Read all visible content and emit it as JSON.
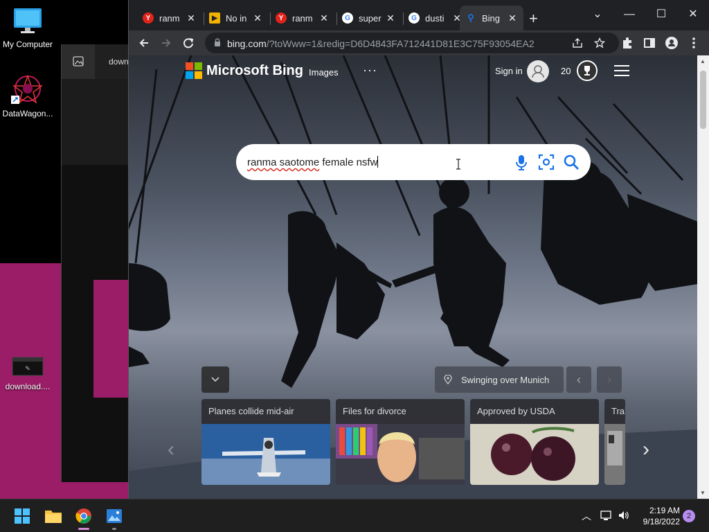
{
  "desktop": {
    "icons": [
      {
        "label": "My Computer",
        "icon": "monitor-icon"
      },
      {
        "label": "DataWagon...",
        "icon": "datawagon-app-icon"
      },
      {
        "label": "download....",
        "icon": "downloaded-file-icon"
      }
    ],
    "background_window": {
      "title_fragment": "down"
    }
  },
  "browser": {
    "tabs": [
      {
        "favicon": "yandex-icon",
        "favicon_glyph": "Y",
        "favicon_color": "#e0241c",
        "label": "ranm",
        "active": false
      },
      {
        "favicon": "image-placeholder-icon",
        "favicon_glyph": "▶",
        "favicon_color": "#f2b200",
        "label": "No in",
        "active": false
      },
      {
        "favicon": "yandex-icon",
        "favicon_glyph": "Y",
        "favicon_color": "#e0241c",
        "label": "ranm",
        "active": false
      },
      {
        "favicon": "google-icon",
        "favicon_glyph": "G",
        "favicon_color": "#ffffff",
        "label": "super",
        "active": false
      },
      {
        "favicon": "google-icon",
        "favicon_glyph": "G",
        "favicon_color": "#ffffff",
        "label": "dusti",
        "active": false
      },
      {
        "favicon": "bing-search-icon",
        "favicon_glyph": "⚲",
        "favicon_color": "#1a73e8",
        "label": "Bing",
        "active": true
      }
    ],
    "new_tab_glyph": "+",
    "window_controls": {
      "dropdown": "⌄",
      "minimize": "—",
      "maximize": "☐",
      "close": "✕"
    },
    "url": {
      "host": "bing.com",
      "path": "/?toWww=1&redig=D6D4843FA712441D81E3C75F93054EA2"
    }
  },
  "bing": {
    "brand": "Microsoft Bing",
    "nav_images": "Images",
    "nav_more": "···",
    "sign_in": "Sign in",
    "points": "20",
    "search_query_part1": "ranma saotome",
    "search_query_part2": " female nsfw",
    "image_info": "Swinging over Munich",
    "news_cards": [
      {
        "title": "Planes collide mid-air",
        "picture": "plane-photo"
      },
      {
        "title": "Files for divorce",
        "picture": "man-portrait-photo"
      },
      {
        "title": "Approved by USDA",
        "picture": "tomatoes-photo"
      },
      {
        "title": "Trai",
        "picture": "train-photo"
      }
    ],
    "logo_colors": [
      "#f25022",
      "#7fba00",
      "#00a4ef",
      "#ffb900"
    ]
  },
  "taskbar": {
    "apps": [
      "windows-start-icon",
      "file-explorer-icon",
      "chrome-icon",
      "photos-icon"
    ],
    "time": "2:19 AM",
    "date": "9/18/2022",
    "notifications": "2"
  }
}
